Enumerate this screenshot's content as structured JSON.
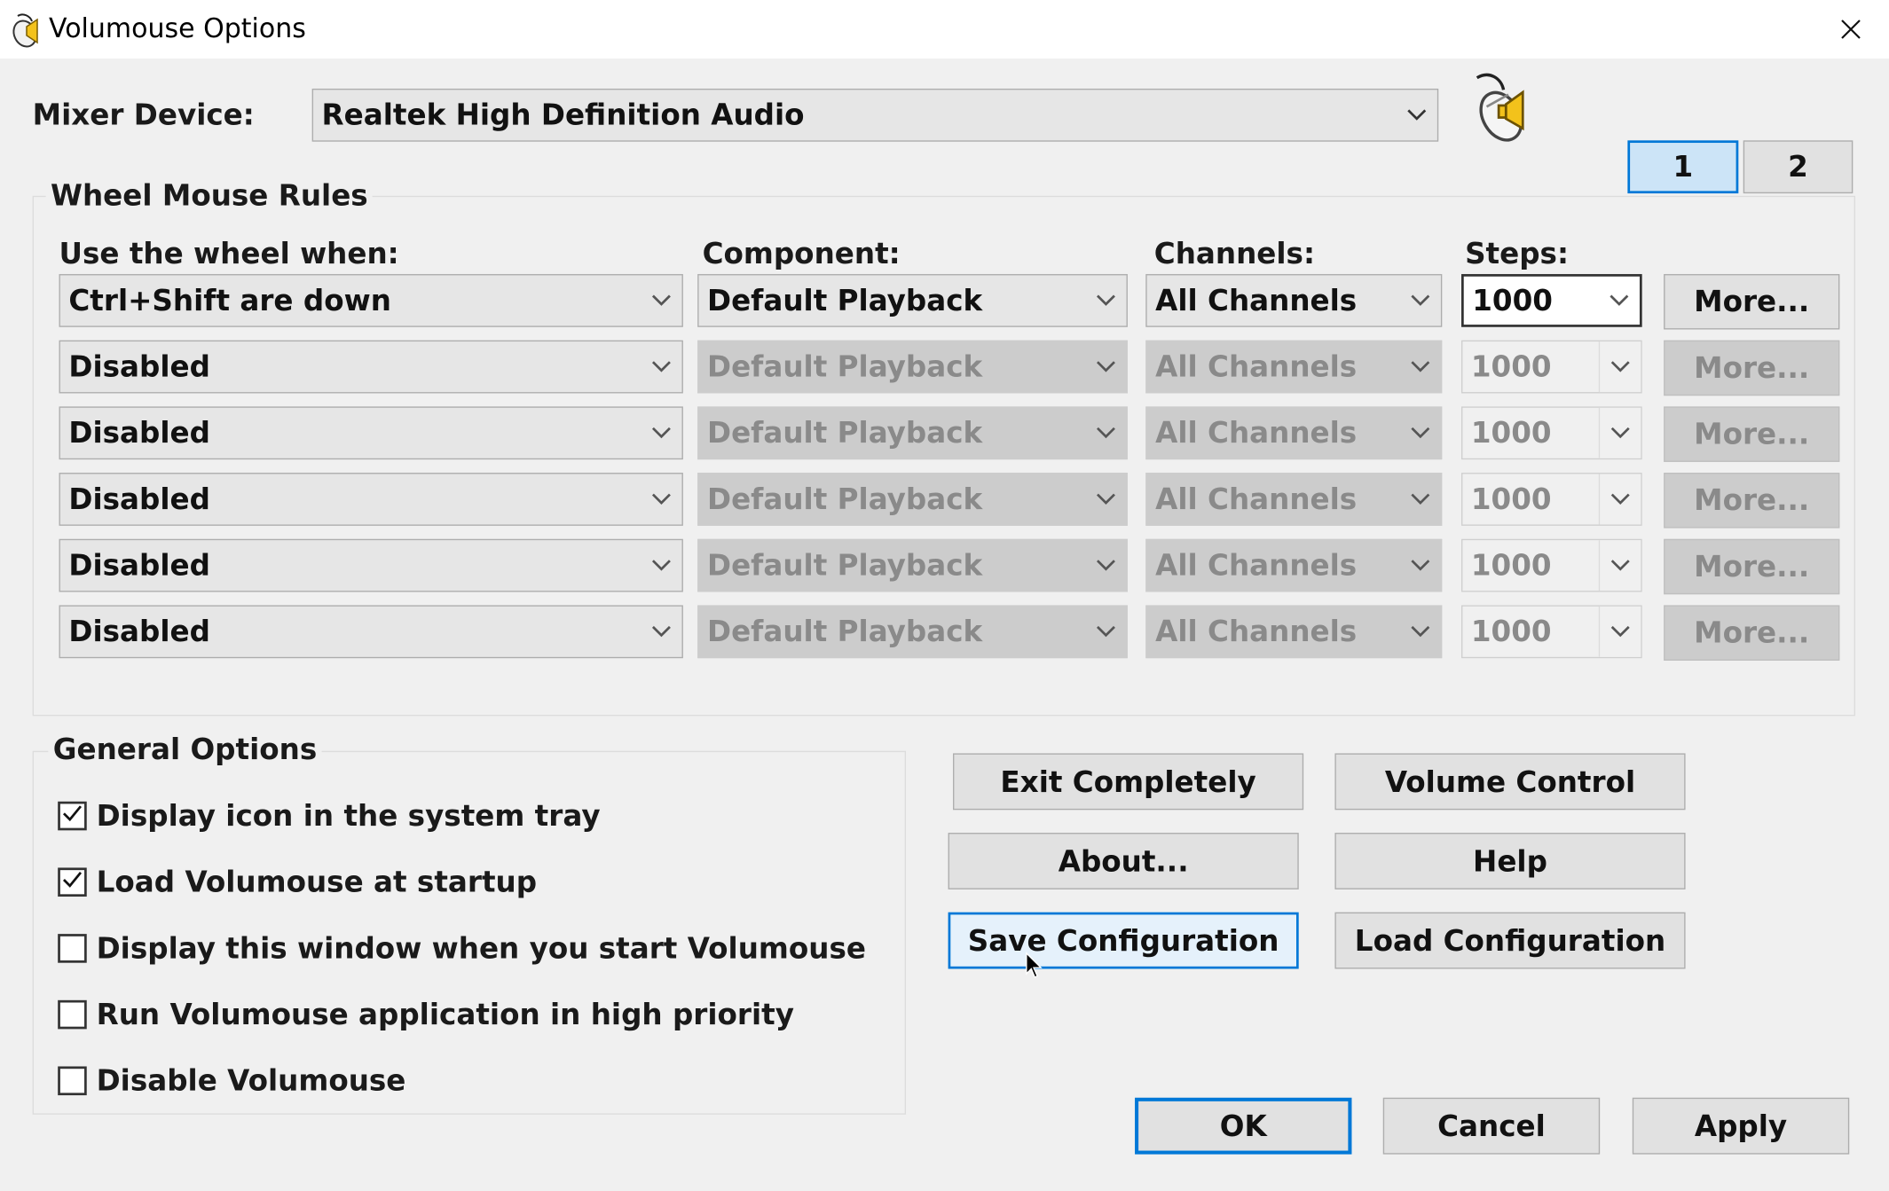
{
  "window": {
    "title": "Volumouse Options",
    "close_glyph": "✕"
  },
  "mixer": {
    "label": "Mixer Device:",
    "value": "Realtek High Definition Audio"
  },
  "pages": [
    {
      "label": "1",
      "selected": true
    },
    {
      "label": "2",
      "selected": false
    }
  ],
  "rules": {
    "title": "Wheel Mouse Rules",
    "headers": {
      "use": "Use the wheel when:",
      "component": "Component:",
      "channels": "Channels:",
      "steps": "Steps:"
    },
    "rows": [
      {
        "when": "Ctrl+Shift are down",
        "component": "Default Playback",
        "channels": "All Channels",
        "steps": "1000",
        "more": "More...",
        "enabled": true
      },
      {
        "when": "Disabled",
        "component": "Default Playback",
        "channels": "All Channels",
        "steps": "1000",
        "more": "More...",
        "enabled": false
      },
      {
        "when": "Disabled",
        "component": "Default Playback",
        "channels": "All Channels",
        "steps": "1000",
        "more": "More...",
        "enabled": false
      },
      {
        "when": "Disabled",
        "component": "Default Playback",
        "channels": "All Channels",
        "steps": "1000",
        "more": "More...",
        "enabled": false
      },
      {
        "when": "Disabled",
        "component": "Default Playback",
        "channels": "All Channels",
        "steps": "1000",
        "more": "More...",
        "enabled": false
      },
      {
        "when": "Disabled",
        "component": "Default Playback",
        "channels": "All Channels",
        "steps": "1000",
        "more": "More...",
        "enabled": false
      }
    ]
  },
  "general": {
    "title": "General Options",
    "options": [
      {
        "label": "Display icon in the system tray",
        "checked": true
      },
      {
        "label": "Load Volumouse at startup",
        "checked": true
      },
      {
        "label": "Display this window when you start Volumouse",
        "checked": false
      },
      {
        "label": "Run Volumouse application in high priority",
        "checked": false
      },
      {
        "label": "Disable Volumouse",
        "checked": false
      }
    ]
  },
  "actions": {
    "exit": "Exit Completely",
    "volume_control": "Volume Control",
    "about": "About...",
    "help": "Help",
    "save": "Save Configuration",
    "load": "Load Configuration"
  },
  "footer": {
    "ok": "OK",
    "cancel": "Cancel",
    "apply": "Apply"
  },
  "colors": {
    "accent": "#0078d7",
    "background": "#f0f0f0",
    "disabled_text": "#8a8a8a"
  },
  "icons": {
    "app": "volumouse-mouse-speaker-icon",
    "dropdown": "chevron-down-icon",
    "check": "checkmark-icon"
  }
}
